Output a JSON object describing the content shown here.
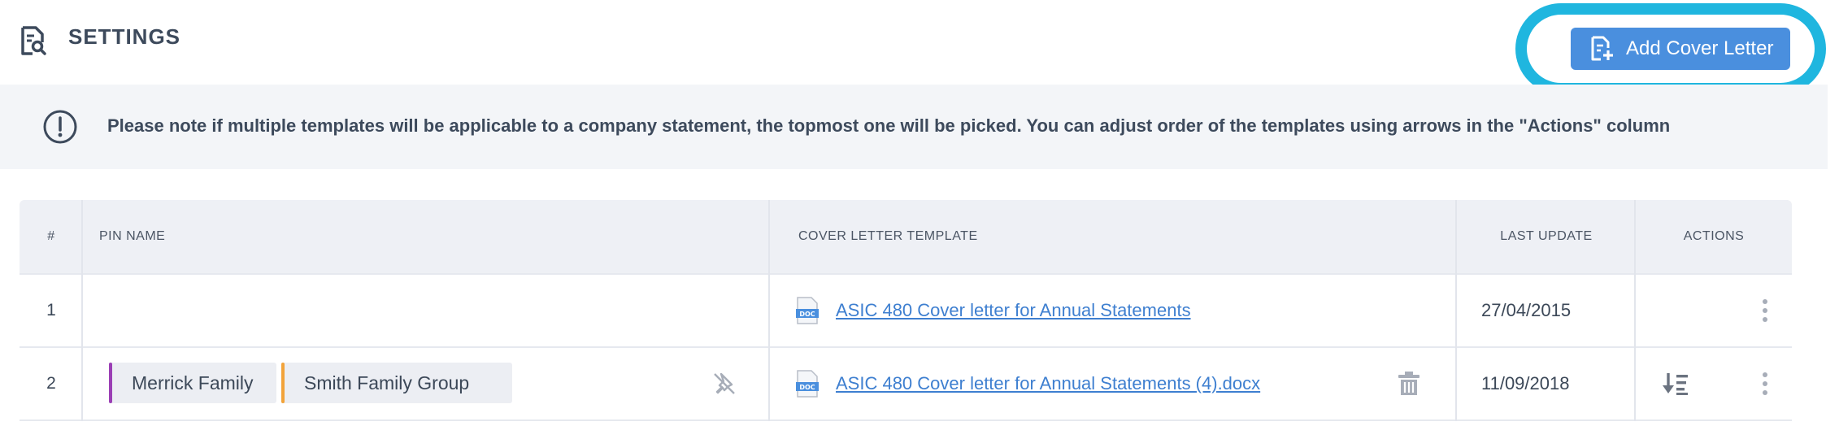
{
  "header": {
    "title": "SETTINGS",
    "add_button_label": "Add Cover Letter"
  },
  "notice": {
    "text": "Please note if multiple templates will be applicable to a company statement, the topmost one will be picked. You can adjust order of the templates using arrows in the \"Actions\" column"
  },
  "table": {
    "columns": [
      "#",
      "PIN NAME",
      "COVER LETTER TEMPLATE",
      "LAST UPDATE",
      "ACTIONS"
    ],
    "rows": [
      {
        "index": "1",
        "pins": [],
        "template": "ASIC 480 Cover letter for Annual Statements",
        "last_update": "27/04/2015"
      },
      {
        "index": "2",
        "pins": [
          {
            "label": "Merrick Family",
            "color": "#9b3fb5"
          },
          {
            "label": "Smith Family Group",
            "color": "#f2a33a"
          }
        ],
        "template": "ASIC 480 Cover letter for Annual Statements (4).docx",
        "last_update": "11/09/2018"
      }
    ]
  },
  "colors": {
    "accent": "#4a8fde",
    "highlight_ring": "#1fb6df",
    "link": "#3e7fd0"
  },
  "icons": [
    "document-search-icon",
    "add-document-icon",
    "info-circle-icon",
    "docx-file-icon",
    "unpin-icon",
    "trash-icon",
    "sort-down-icon",
    "kebab-menu-icon"
  ]
}
